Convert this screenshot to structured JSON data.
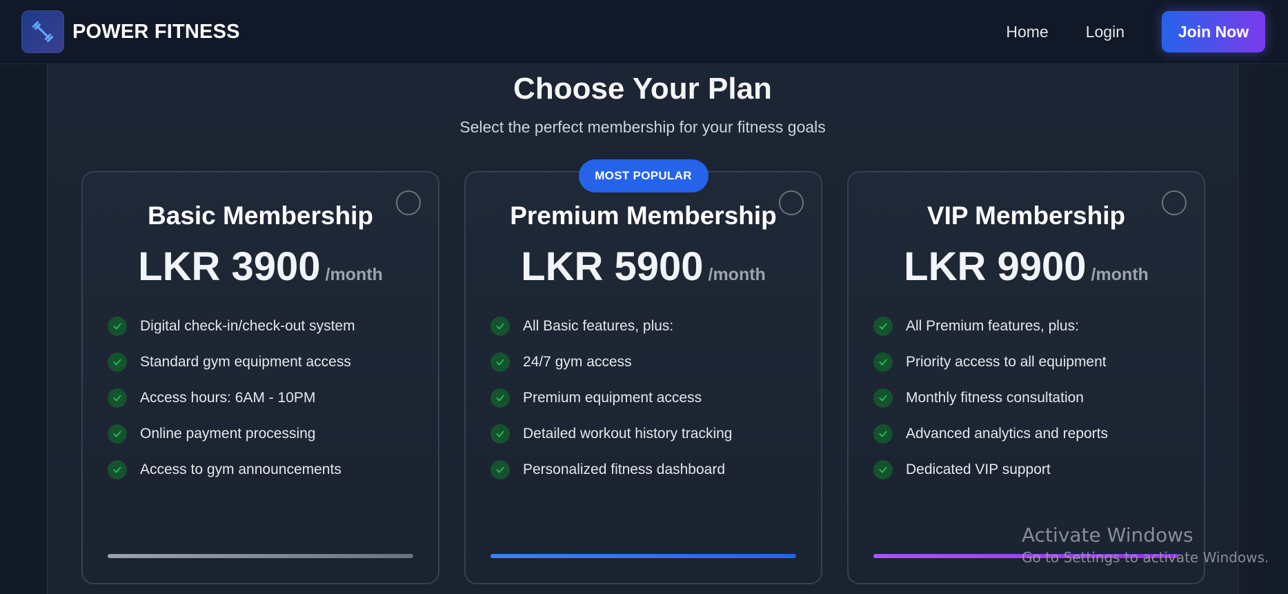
{
  "header": {
    "logo_icon": "dumbbell-icon",
    "brand": "POWER FITNESS",
    "nav": {
      "home": "Home",
      "login": "Login",
      "join": "Join Now"
    }
  },
  "main": {
    "title": "Choose Your Plan",
    "subtitle": "Select the perfect membership for your fitness goals"
  },
  "plans": [
    {
      "name": "Basic Membership",
      "price": "LKR 3900",
      "period": "/month",
      "badge": "",
      "accent": "#9ca3af",
      "selected": false,
      "features": [
        "Digital check-in/check-out system",
        "Standard gym equipment access",
        "Access hours: 6AM - 10PM",
        "Online payment processing",
        "Access to gym announcements"
      ]
    },
    {
      "name": "Premium Membership",
      "price": "LKR 5900",
      "period": "/month",
      "badge": "MOST POPULAR",
      "accent": "#3b82f6",
      "selected": false,
      "features": [
        "All Basic features, plus:",
        "24/7 gym access",
        "Premium equipment access",
        "Detailed workout history tracking",
        "Personalized fitness dashboard"
      ]
    },
    {
      "name": "VIP Membership",
      "price": "LKR 9900",
      "period": "/month",
      "badge": "",
      "accent": "#a855f7",
      "selected": false,
      "features": [
        "All Premium features, plus:",
        "Priority access to all equipment",
        "Monthly fitness consultation",
        "Advanced analytics and reports",
        "Dedicated VIP support"
      ]
    }
  ],
  "watermark": {
    "title": "Activate Windows",
    "subtitle": "Go to Settings to activate Windows."
  },
  "colors": {
    "primary": "#2563eb",
    "secondary": "#7c3aed",
    "check": "#22c55e",
    "background": "#1b2331"
  }
}
